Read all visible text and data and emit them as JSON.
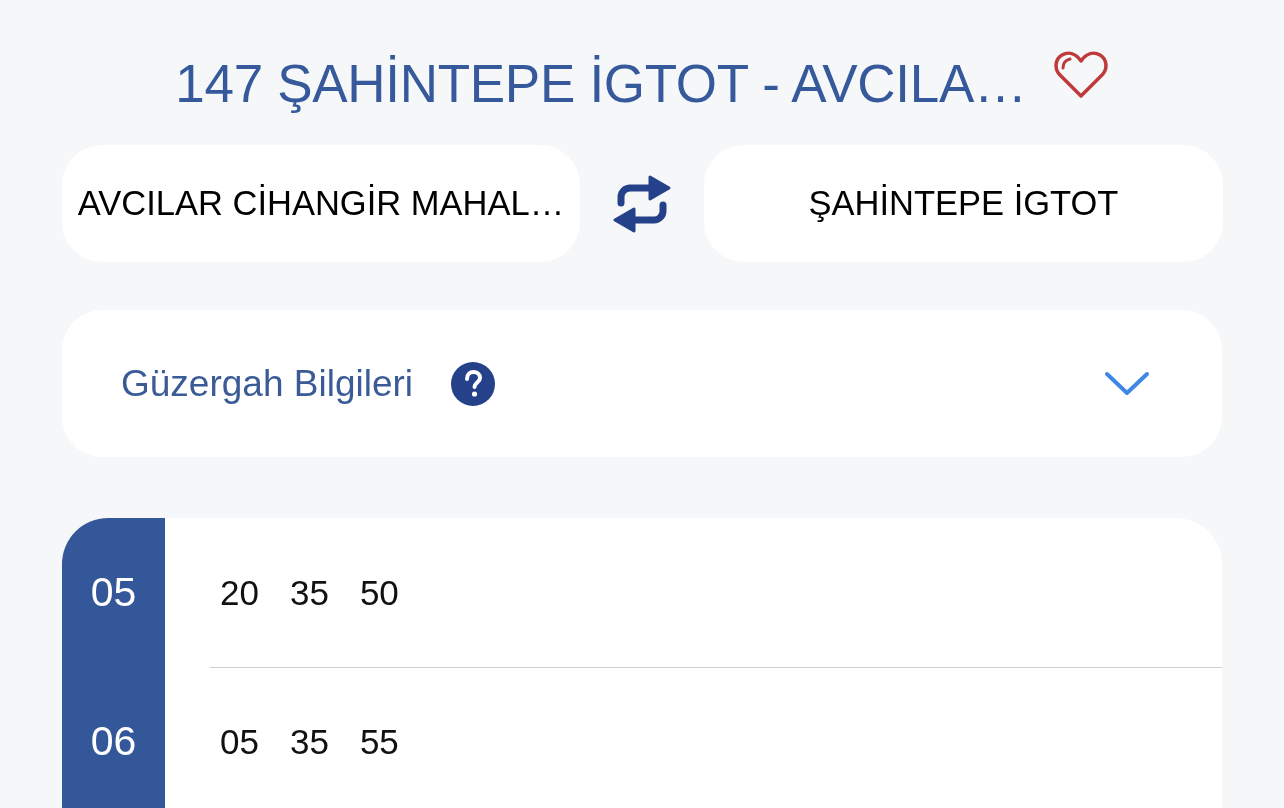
{
  "header": {
    "title": "147 ŞAHİNTEPE İGTOT - AVCILA…",
    "favorite": false
  },
  "stops": {
    "from": "AVCILAR CİHANGİR MAHAL…",
    "to": "ŞAHİNTEPE İGTOT"
  },
  "route_info": {
    "label": "Güzergah Bilgileri",
    "expanded": false
  },
  "timetable": [
    {
      "hour": "05",
      "minutes": [
        "20",
        "35",
        "50"
      ]
    },
    {
      "hour": "06",
      "minutes": [
        "05",
        "35",
        "55"
      ]
    }
  ]
}
